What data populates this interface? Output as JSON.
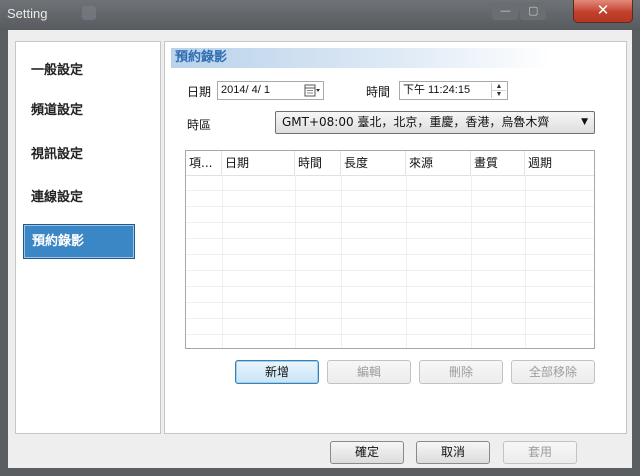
{
  "window": {
    "title": "Setting",
    "close_glyph": "✕"
  },
  "sidebar": {
    "items": [
      {
        "label": "一般設定"
      },
      {
        "label": "頻道設定"
      },
      {
        "label": "視訊設定"
      },
      {
        "label": "連線設定"
      },
      {
        "label": "預約錄影",
        "active": true
      }
    ]
  },
  "main": {
    "section_title": "預約錄影",
    "date_label": "日期",
    "date_value": "2014/  4/  1",
    "time_label": "時間",
    "time_value": "下午 11:24:15",
    "timezone_label": "時區",
    "timezone_value": "GMT+08:00 臺北，北京，重慶，香港，烏魯木齊",
    "table": {
      "columns": [
        "項...",
        "日期",
        "時間",
        "長度",
        "來源",
        "畫質",
        "週期"
      ],
      "rows": []
    },
    "buttons": {
      "add": "新增",
      "edit": "編輯",
      "delete": "刪除",
      "remove_all": "全部移除"
    }
  },
  "footer": {
    "ok": "確定",
    "cancel": "取消",
    "apply": "套用"
  },
  "icons": {
    "calendar": "calendar-icon",
    "dropdown": "chevron-down-icon",
    "spin": "spinner-icon"
  },
  "colors": {
    "accent": "#3b86c4",
    "header_text": "#2e6db3",
    "close_button": "#c2412c"
  }
}
